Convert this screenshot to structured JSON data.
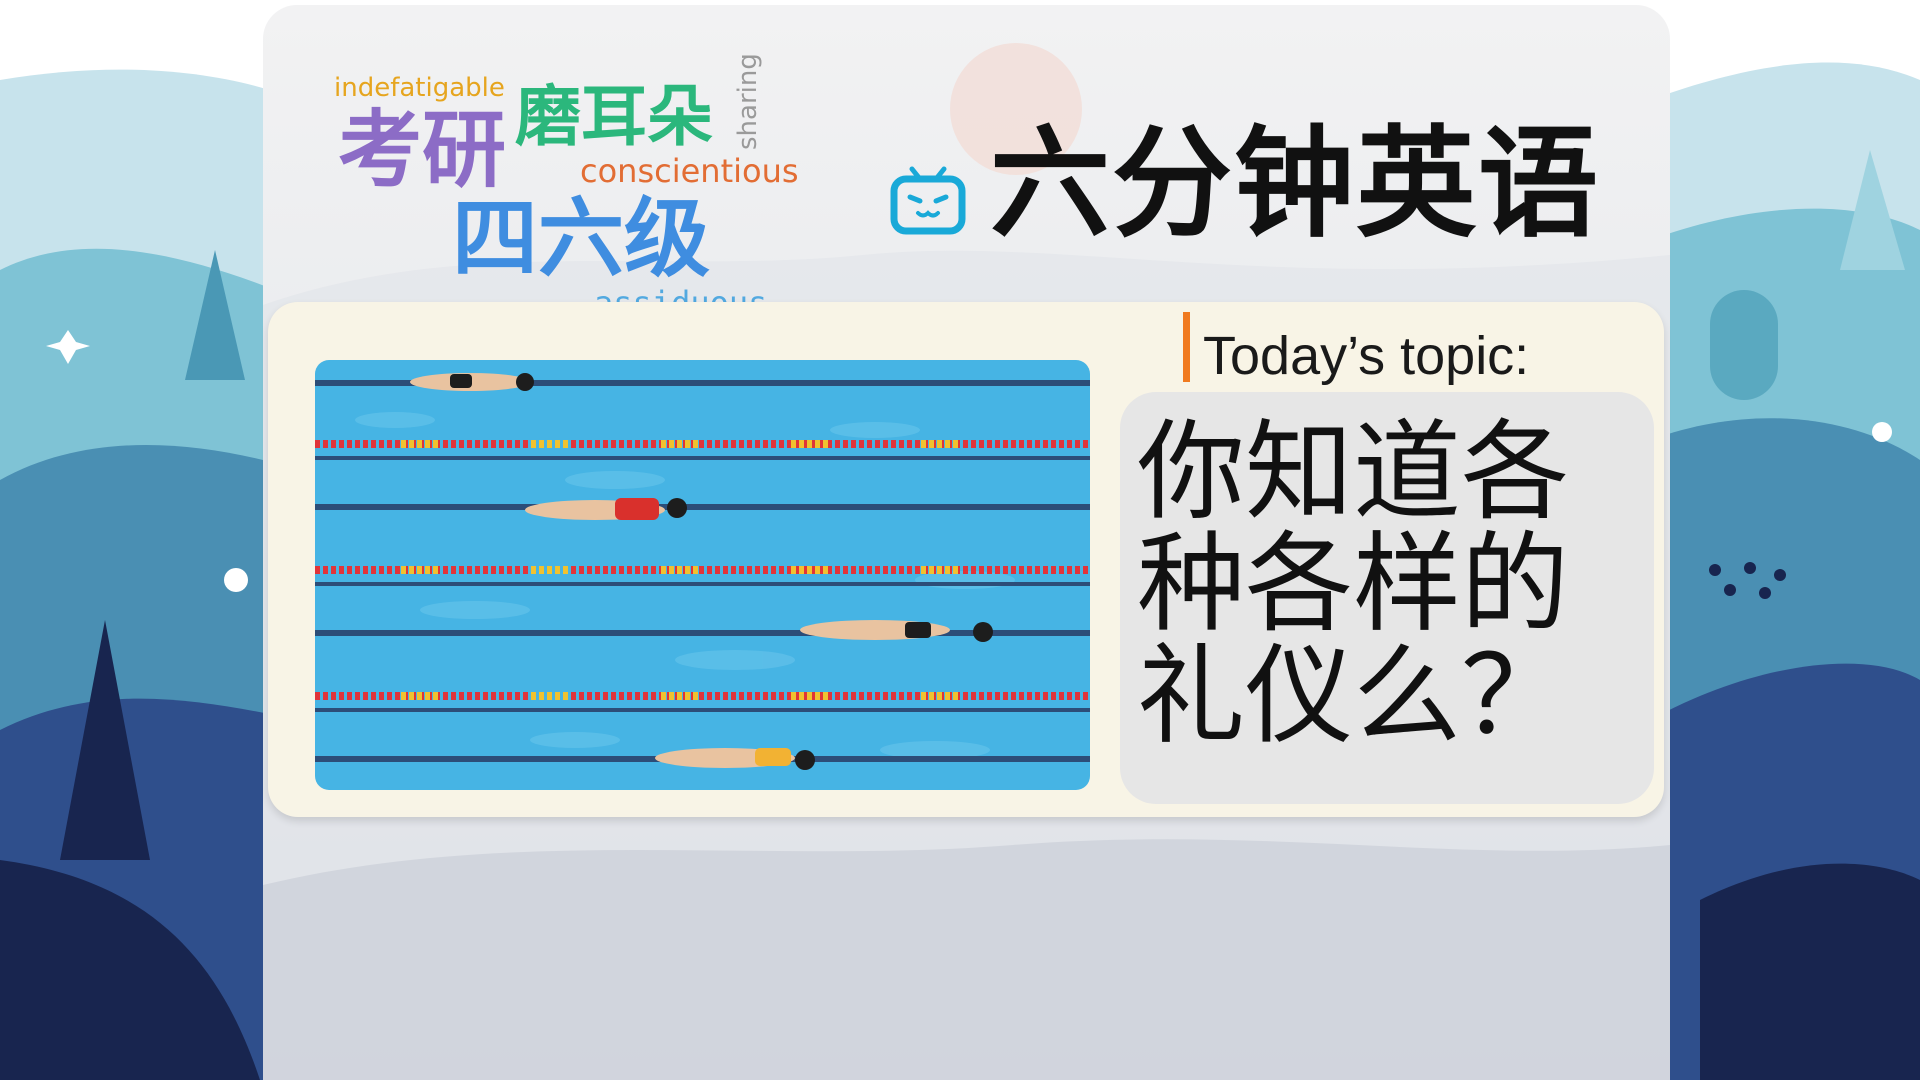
{
  "title": "六分钟英语",
  "word_cloud": {
    "indefatigable": "indefatigable",
    "kaoyan": "考研",
    "moerduo": "磨耳朵",
    "sharing": "sharing",
    "conscientious": "conscientious",
    "siliuji": "四六级",
    "assiduous": "assiduous"
  },
  "topic": {
    "label": "Today’s topic:",
    "question": "你知道各种各样的礼仪么？"
  },
  "colors": {
    "accent_bar": "#f07a1f",
    "tv_icon": "#19a9d8",
    "background_hills": "#2f4f8c"
  },
  "icons": [
    "tv-logo-icon"
  ]
}
